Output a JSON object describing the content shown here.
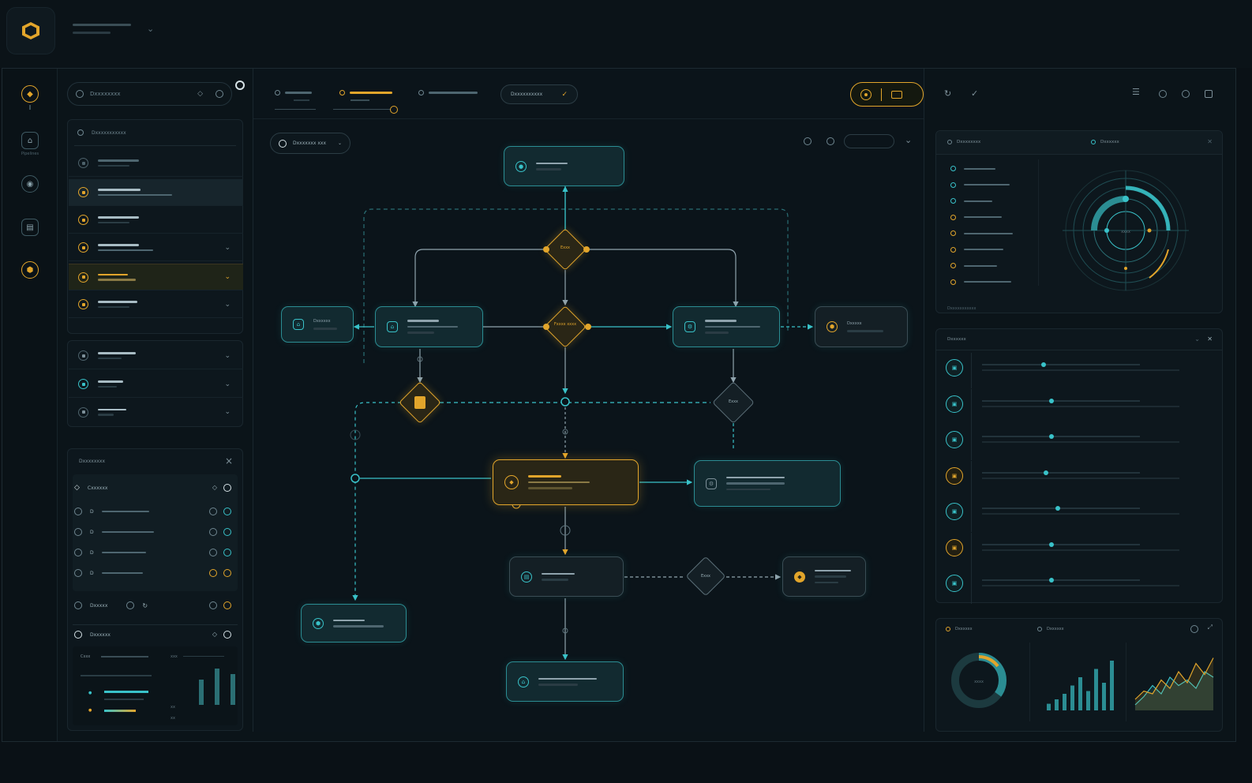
{
  "colors": {
    "accent_gold": "#e2a52b",
    "accent_teal": "#39c2c9",
    "background": "#0a1116",
    "panel": "#0d171d"
  },
  "workspace": {
    "title": "",
    "chevron": "⌄"
  },
  "rail": {
    "items": [
      {
        "icon": "shield-icon",
        "label": ""
      },
      {
        "icon": "workflow-icon",
        "label": "Pipelines"
      },
      {
        "icon": "target-icon",
        "label": ""
      },
      {
        "icon": "document-icon",
        "label": ""
      },
      {
        "icon": "hexagon-icon",
        "label": ""
      }
    ]
  },
  "search": {
    "placeholder": "Dxxxxxxxx"
  },
  "nav": {
    "header": "Dxxxxxxxxxxx",
    "items": [
      {
        "label": "",
        "state": "normal"
      },
      {
        "label": "",
        "state": "selected"
      },
      {
        "label": "",
        "state": "normal"
      },
      {
        "label": "",
        "state": "normal"
      },
      {
        "label": "",
        "state": "active"
      },
      {
        "label": "",
        "state": "normal"
      }
    ],
    "groups": [
      {
        "label": ""
      },
      {
        "label": ""
      },
      {
        "label": ""
      }
    ]
  },
  "filters": {
    "title": "Dxxxxxxxx",
    "close": "×",
    "rows": [
      {
        "label": "Cxxxxxx"
      },
      {
        "label": "D"
      },
      {
        "label": "D"
      },
      {
        "label": "D"
      },
      {
        "label": "D"
      }
    ],
    "footer_label": "Dxxxxx",
    "summary_label": "Dxxxxxx",
    "stats": [
      "Cxxx",
      "xxx",
      "xx",
      "xx"
    ],
    "bars": [
      0.7,
      1.0,
      0.85
    ]
  },
  "tabs": [
    {
      "label": "",
      "active": false
    },
    {
      "label": "",
      "active": true
    },
    {
      "label": "",
      "active": false
    }
  ],
  "toolbar": {
    "dropdown_label": "Dxxxxxxxxxx",
    "check": "✓"
  },
  "canvas": {
    "filter_label": "Dxxxxxxx xxx",
    "nodes": [
      {
        "id": "start",
        "label": ""
      },
      {
        "id": "left-edge",
        "label": "Dxxxxxx"
      },
      {
        "id": "left",
        "label": ""
      },
      {
        "id": "right",
        "label": ""
      },
      {
        "id": "right-edge",
        "label": "Dxxxxx"
      },
      {
        "id": "main",
        "label": ""
      },
      {
        "id": "main-right",
        "label": ""
      },
      {
        "id": "lower",
        "label": ""
      },
      {
        "id": "lower-right",
        "label": ""
      },
      {
        "id": "bottom-left",
        "label": ""
      },
      {
        "id": "end",
        "label": ""
      }
    ],
    "decisions": [
      {
        "id": "d-top",
        "label": "Exxx"
      },
      {
        "id": "d-mid",
        "label": "Fxxxx xxxx"
      },
      {
        "id": "d-left",
        "label": ""
      },
      {
        "id": "d-right",
        "label": "Exxx"
      },
      {
        "id": "d-low",
        "label": "Exxx"
      }
    ]
  },
  "radar": {
    "title": "Dxxxxxxxx",
    "subtitle": "Dxxxxxx",
    "center": "xxxx",
    "footer": "Dxxxxxxxxxxx",
    "rows": 8
  },
  "list_panel": {
    "title": "Dxxxxxx",
    "rows": [
      {
        "color": "teal",
        "progress": 0.3
      },
      {
        "color": "teal",
        "progress": 0.34
      },
      {
        "color": "teal",
        "progress": 0.34
      },
      {
        "color": "gold",
        "progress": 0.31
      },
      {
        "color": "teal",
        "progress": 0.37
      },
      {
        "color": "gold",
        "progress": 0.34
      },
      {
        "color": "teal",
        "progress": 0.34
      }
    ]
  },
  "charts": {
    "donut_title": "Dxxxxxx",
    "bars_title": "Dxxxxxx",
    "donut_center": "xxxx",
    "donut_fraction": 0.35,
    "bar_values": [
      0.12,
      0.2,
      0.3,
      0.45,
      0.6,
      0.35,
      0.75,
      0.5,
      0.9
    ],
    "line_a": [
      0.2,
      0.35,
      0.3,
      0.55,
      0.4,
      0.7,
      0.5,
      0.85,
      0.65,
      0.95
    ],
    "line_b": [
      0.1,
      0.25,
      0.45,
      0.3,
      0.6,
      0.45,
      0.55,
      0.4,
      0.7,
      0.6
    ]
  }
}
